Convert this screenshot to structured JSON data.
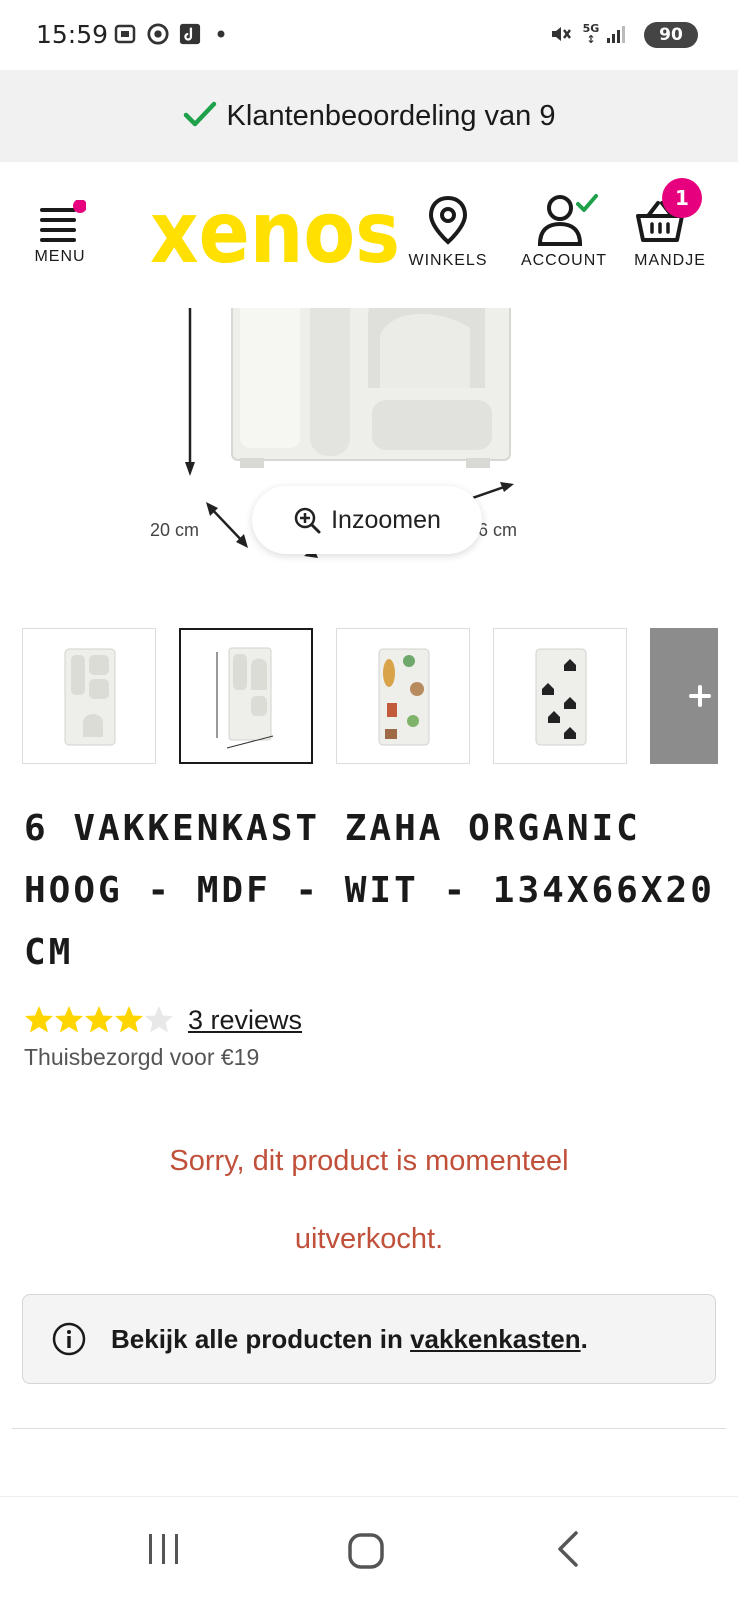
{
  "status_bar": {
    "time": "15:59",
    "network": "5G",
    "battery": "90",
    "icons": [
      "screenshot-icon",
      "chrome-icon",
      "tiktok-icon",
      "dot-icon",
      "mute-icon",
      "signal-icon",
      "battery-icon"
    ]
  },
  "review_banner": {
    "text": "Klantenbeoordeling van 9",
    "icon": "checkmark-icon",
    "icon_color": "#1fa04a"
  },
  "header": {
    "menu_label": "MENU",
    "logo_text": "xenos",
    "stores_label": "WINKELS",
    "account_label": "ACCOUNT",
    "cart_label": "MANDJE",
    "cart_count": "1",
    "accent_color": "#e6007e",
    "logo_color": "#ffe000"
  },
  "product_image": {
    "dim_depth": "20 cm",
    "dim_width": "66 cm",
    "zoom_label": "Inzoomen"
  },
  "thumbnails": {
    "count_visible": 5,
    "selected_index": 1,
    "more_icon": "plus-icon"
  },
  "product": {
    "title": "6 VAKKENKAST ZAHA ORGANIC HOOG - MDF - WIT - 134X66X20 CM",
    "rating": 4.5,
    "rating_max": 5,
    "reviews_label": "3 reviews",
    "delivery": "Thuisbezorgd voor €19",
    "star_color": "#ffd500"
  },
  "availability": {
    "line1": "Sorry, dit product is momenteel",
    "line2": "uitverkocht.",
    "color": "#c0503a"
  },
  "info_box": {
    "prefix": "Bekijk alle producten in ",
    "link": "vakkenkasten",
    "suffix": "."
  }
}
